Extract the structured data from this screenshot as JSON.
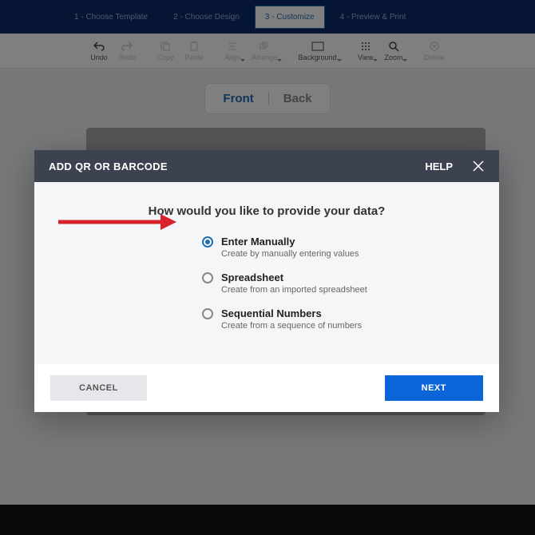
{
  "steps": {
    "one": "1 - Choose Template",
    "two": "2 - Choose Design",
    "three": "3 - Customize",
    "four": "4 - Preview & Print"
  },
  "toolbar": {
    "undo": "Undo",
    "redo": "Redo",
    "copy": "Copy",
    "paste": "Paste",
    "align": "Align",
    "arrange": "Arrange",
    "background": "Background",
    "view": "View",
    "zoom": "Zoom",
    "delete": "Delete"
  },
  "fb": {
    "front": "Front",
    "back": "Back"
  },
  "modal": {
    "title": "ADD QR OR BARCODE",
    "help": "HELP",
    "question": "How would you like to provide your data?",
    "options": [
      {
        "title": "Enter Manually",
        "desc": "Create by manually entering values"
      },
      {
        "title": "Spreadsheet",
        "desc": "Create from an imported spreadsheet"
      },
      {
        "title": "Sequential Numbers",
        "desc": "Create from a sequence of numbers"
      }
    ],
    "cancel": "CANCEL",
    "next": "NEXT"
  }
}
